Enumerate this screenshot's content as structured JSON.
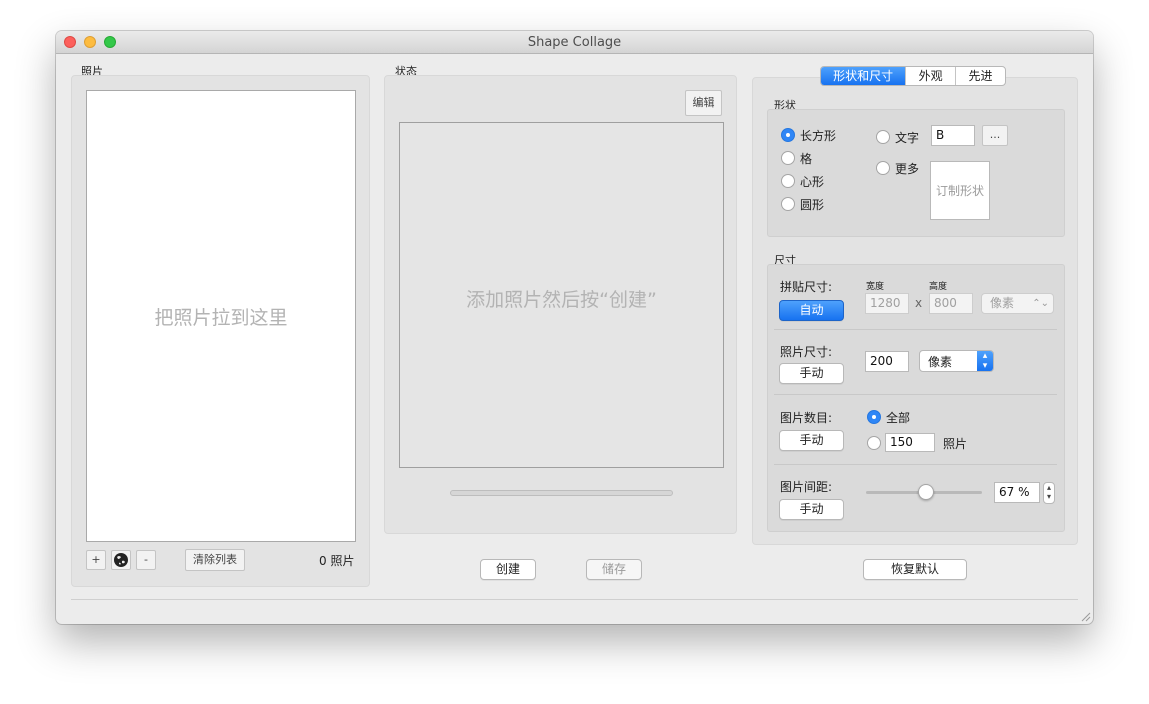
{
  "window": {
    "title": "Shape Collage"
  },
  "photos": {
    "section_label": "照片",
    "drop_hint": "把照片拉到这里",
    "add_label": "+",
    "remove_label": "-",
    "clear_label": "清除列表",
    "count_label": "0 照片"
  },
  "status": {
    "section_label": "状态",
    "edit_label": "编辑",
    "hint": "添加照片然后按“创建”",
    "progress": 0
  },
  "actions": {
    "create_label": "创建",
    "save_label": "储存",
    "reset_label": "恢复默认"
  },
  "tabs": [
    {
      "label": "形状和尺寸",
      "active": true
    },
    {
      "label": "外观",
      "active": false
    },
    {
      "label": "先进",
      "active": false
    }
  ],
  "shape": {
    "section_label": "形状",
    "options": [
      {
        "label": "长方形",
        "selected": true
      },
      {
        "label": "格",
        "selected": false
      },
      {
        "label": "心形",
        "selected": false
      },
      {
        "label": "圆形",
        "selected": false
      }
    ],
    "text_option": {
      "label": "文字",
      "value": "B",
      "browse_label": "...",
      "selected": false
    },
    "more_option": {
      "label": "更多",
      "selected": false
    },
    "custom_shape_label": "订制形状"
  },
  "size": {
    "section_label": "尺寸",
    "collage": {
      "label": "拼贴尺寸:",
      "button": "自动",
      "width_label": "宽度",
      "height_label": "高度",
      "width": "1280",
      "height": "800",
      "times": "x",
      "unit": "像素"
    },
    "photo": {
      "label": "照片尺寸:",
      "button": "手动",
      "value": "200",
      "unit": "像素"
    },
    "count": {
      "label": "图片数目:",
      "button": "手动",
      "all_label": "全部",
      "all_selected": true,
      "value": "150",
      "unit_label": "照片"
    },
    "spacing": {
      "label": "图片间距:",
      "button": "手动",
      "percent": 67,
      "display": "67 %"
    }
  },
  "colors": {
    "accent": "#2f86f6",
    "close": "#fc605c",
    "minimize": "#fdbc40",
    "zoom": "#34c84a"
  }
}
